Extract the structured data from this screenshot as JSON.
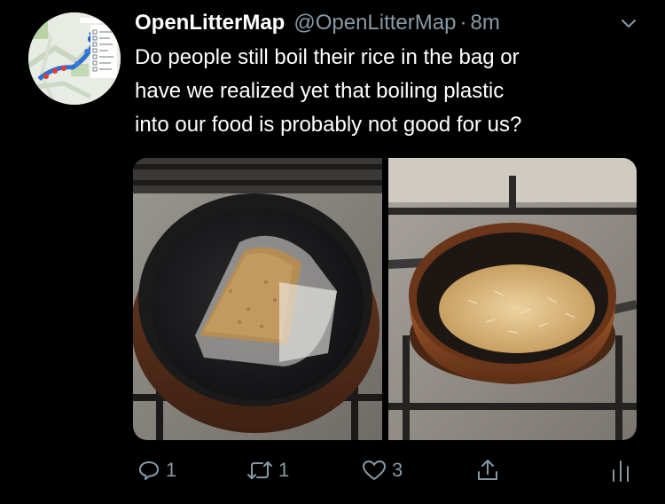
{
  "tweet": {
    "display_name": "OpenLitterMap",
    "handle": "@OpenLitterMap",
    "separator": "·",
    "time": "8m",
    "text_lines": [
      "Do people still boil their rice in the bag or",
      "have we realized yet that boiling plastic",
      "into our food is probably not good for us?"
    ]
  },
  "actions": {
    "reply_count": "1",
    "retweet_count": "1",
    "like_count": "3"
  },
  "icons": {
    "reply": "reply-icon",
    "retweet": "retweet-icon",
    "like": "heart-icon",
    "share": "share-icon",
    "analytics": "analytics-icon",
    "more": "chevron-down-icon"
  },
  "colors": {
    "background": "#000000",
    "text": "#ffffff",
    "secondary": "#8899a6"
  }
}
